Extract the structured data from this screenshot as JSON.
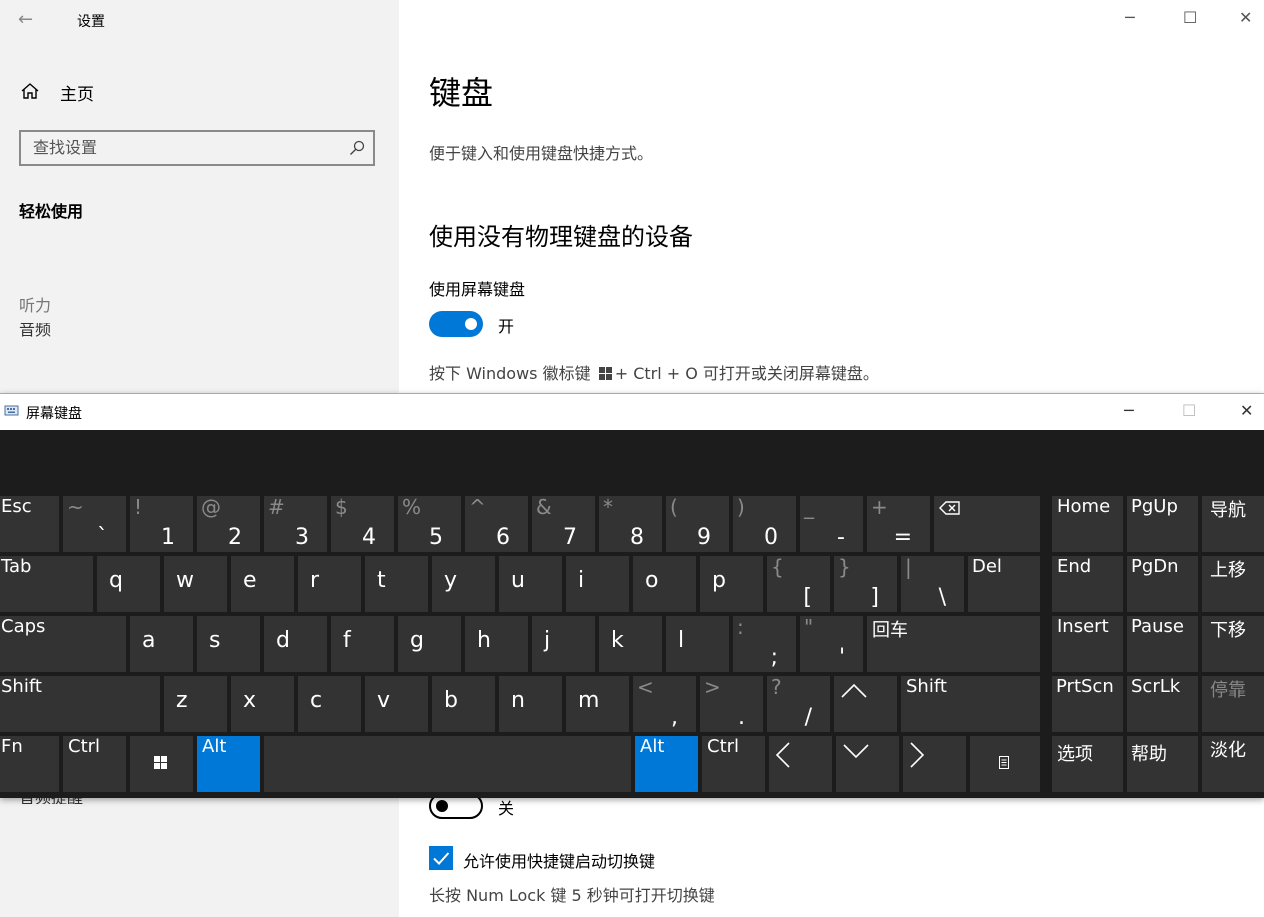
{
  "settings": {
    "title": "设置",
    "home": "主页",
    "search_placeholder": "查找设置",
    "section": "轻松使用",
    "group": "听力",
    "clipped_item": "音频",
    "clipped_bottom": "音频提醒",
    "page_title": "键盘",
    "page_desc": "便于键入和使用键盘快捷方式。",
    "subheading": "使用没有物理键盘的设备",
    "osk_label": "使用屏幕键盘",
    "osk_toggle_state": "开",
    "osk_hint_pre": "按下 Windows 徽标键",
    "osk_hint_post": "+ Ctrl + O 可打开或关闭屏幕键盘。",
    "second_toggle_state": "关",
    "checkbox_label": "允许使用快捷键启动切换键",
    "checkbox_checked": true,
    "checkbox_hint": "长按 Num Lock 键 5 秒钟可打开切换键",
    "accent_color": "#0078d7"
  },
  "osk": {
    "title": "屏幕键盘",
    "key_bg": "#333333",
    "highlight_bg": "#0078d7",
    "keyboard_bg": "#1c1c1c",
    "highlighted_keys": [
      "Alt",
      "Alt"
    ],
    "rows": [
      [
        "Esc",
        "~ `",
        "! 1",
        "@ 2",
        "# 3",
        "$ 4",
        "% 5",
        "^ 6",
        "& 7",
        "* 8",
        "( 9",
        ") 0",
        "_ -",
        "+ =",
        "Backspace",
        "Home",
        "PgUp",
        "导航"
      ],
      [
        "Tab",
        "q",
        "w",
        "e",
        "r",
        "t",
        "y",
        "u",
        "i",
        "o",
        "p",
        "{ [",
        "} ]",
        "| \\",
        "Del",
        "End",
        "PgDn",
        "上移"
      ],
      [
        "Caps",
        "a",
        "s",
        "d",
        "f",
        "g",
        "h",
        "j",
        "k",
        "l",
        ": ;",
        "\" '",
        "回车",
        "Insert",
        "Pause",
        "下移"
      ],
      [
        "Shift",
        "z",
        "x",
        "c",
        "v",
        "b",
        "n",
        "m",
        "< ,",
        "> .",
        "? /",
        "Up",
        "Shift",
        "PrtScn",
        "ScrLk",
        "停靠"
      ],
      [
        "Fn",
        "Ctrl",
        "Windows",
        "Alt",
        "Space",
        "Alt",
        "Ctrl",
        "Left",
        "Down",
        "Right",
        "Menu",
        "选项",
        "帮助",
        "淡化"
      ]
    ],
    "labels": {
      "esc": "Esc",
      "tab": "Tab",
      "caps": "Caps",
      "shift": "Shift",
      "fn": "Fn",
      "ctrl": "Ctrl",
      "alt": "Alt",
      "del": "Del",
      "enter": "回车",
      "home": "Home",
      "pgup": "PgUp",
      "nav": "导航",
      "end": "End",
      "pgdn": "PgDn",
      "moveup": "上移",
      "insert": "Insert",
      "pause": "Pause",
      "movedown": "下移",
      "prtscn": "PrtScn",
      "scrlk": "ScrLk",
      "dock": "停靠",
      "options": "选项",
      "help": "帮助",
      "fade": "淡化",
      "tilde": "~",
      "backtick": "`",
      "excl": "!",
      "one": "1",
      "at": "@",
      "two": "2",
      "hash": "#",
      "three": "3",
      "dollar": "$",
      "four": "4",
      "pct": "%",
      "five": "5",
      "caret": "^",
      "six": "6",
      "amp": "&",
      "seven": "7",
      "star": "*",
      "eight": "8",
      "lparen": "(",
      "nine": "9",
      "rparen": ")",
      "zero": "0",
      "under": "_",
      "minus": "-",
      "plus": "+",
      "equal": "=",
      "q": "q",
      "w": "w",
      "e": "e",
      "r": "r",
      "t": "t",
      "y": "y",
      "u": "u",
      "i": "i",
      "o": "o",
      "p": "p",
      "lbrace": "{",
      "lbracket": "[",
      "rbrace": "}",
      "rbracket": "]",
      "pipe": "|",
      "backslash": "\\",
      "a": "a",
      "s": "s",
      "d": "d",
      "f": "f",
      "g": "g",
      "h": "h",
      "j": "j",
      "k": "k",
      "l": "l",
      "colon": ":",
      "semicolon": ";",
      "dquote": "\"",
      "squote": "'",
      "z": "z",
      "x": "x",
      "c": "c",
      "v": "v",
      "b": "b",
      "n": "n",
      "m": "m",
      "lt": "<",
      "comma": ",",
      "gt": ">",
      "period": ".",
      "question": "?",
      "slash": "/",
      "up": "︿",
      "down": "﹀",
      "left": "〈",
      "right": "〉"
    }
  }
}
